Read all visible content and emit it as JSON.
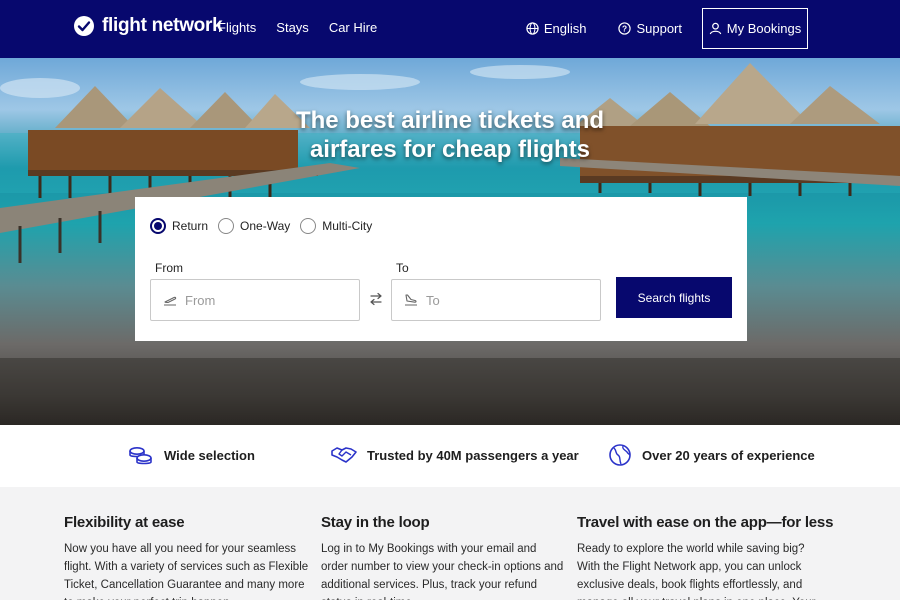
{
  "header": {
    "brand": "flight network",
    "nav_links": [
      "Flights",
      "Stays",
      "Car Hire"
    ],
    "language": "English",
    "support": "Support",
    "my_bookings": "My Bookings"
  },
  "hero": {
    "title": "The best airline tickets and airfares for cheap flights"
  },
  "search": {
    "trip_types": [
      "Return",
      "One-Way",
      "Multi-City"
    ],
    "selected_trip_type": "Return",
    "from_label": "From",
    "from_placeholder": "From",
    "from_value": "",
    "to_label": "To",
    "to_placeholder": "To",
    "to_value": "",
    "button": "Search flights"
  },
  "features": [
    {
      "icon": "coins-icon",
      "text": "Wide selection"
    },
    {
      "icon": "handshake-icon",
      "text": "Trusted by 40M passengers a year"
    },
    {
      "icon": "globe-icon",
      "text": "Over 20 years of experience"
    }
  ],
  "info": [
    {
      "title": "Flexibility at ease",
      "body": "Now you have all you need for your seamless flight. With a variety of services such as Flexible Ticket, Cancellation Guarantee and many more to make your perfect trip happen."
    },
    {
      "title": "Stay in the loop",
      "body": "Log in to My Bookings with your email and order number to view your check-in options and additional services. Plus, track your refund status in real-time."
    },
    {
      "title": "Travel with ease on the app—for less",
      "body": "Ready to explore the world while saving big? With the Flight Network app, you can unlock exclusive deals, book flights effortlessly, and manage all your travel plans in one place. Your next adventure starts now."
    }
  ],
  "colors": {
    "brand_navy": "#07086e",
    "accent_blue": "#2b33c9"
  }
}
